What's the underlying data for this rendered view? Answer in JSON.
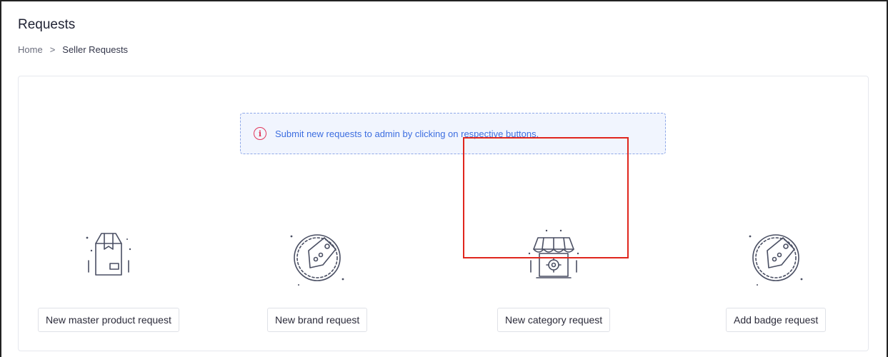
{
  "header": {
    "title": "Requests",
    "breadcrumb": {
      "home": "Home",
      "separator": ">",
      "current": "Seller Requests"
    }
  },
  "info": {
    "icon": "info-circle-icon",
    "text": "Submit new requests to admin by clicking on respective buttons."
  },
  "requests": [
    {
      "icon": "box-icon",
      "label": "New master product request"
    },
    {
      "icon": "tag-icon",
      "label": "New brand request"
    },
    {
      "icon": "store-gear-icon",
      "label": "New category request",
      "highlighted": true
    },
    {
      "icon": "tag-icon",
      "label": "Add badge request"
    }
  ],
  "colors": {
    "accent": "#3d6ee0",
    "info_icon": "#e2385b",
    "info_bg": "#f1f5fe",
    "highlight": "#e0261d",
    "illustration_stroke": "#4a4f63"
  }
}
